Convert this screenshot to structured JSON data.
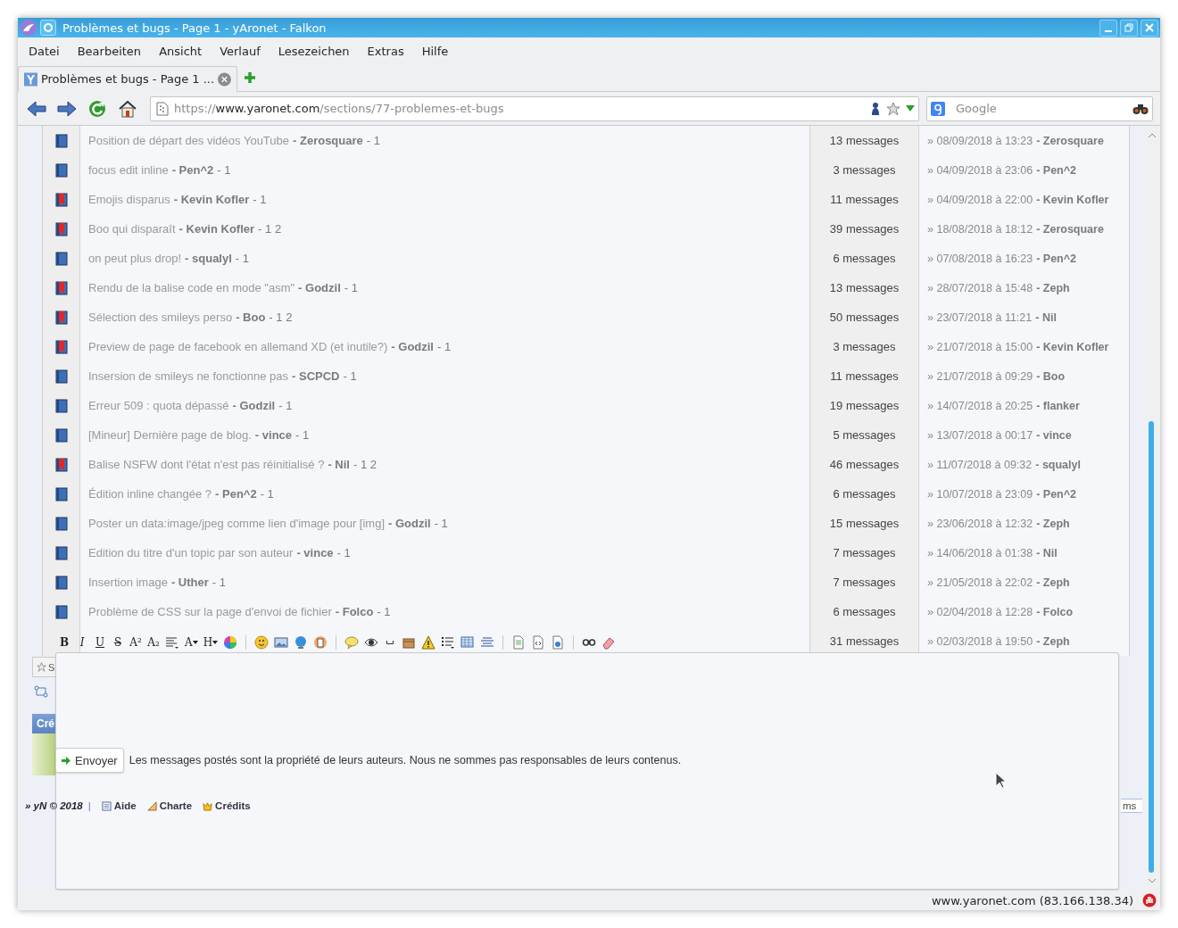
{
  "window": {
    "title": "Problèmes et bugs - Page 1 - yAronet - Falkon"
  },
  "menu": [
    "Datei",
    "Bearbeiten",
    "Ansicht",
    "Verlauf",
    "Lesezeichen",
    "Extras",
    "Hilfe"
  ],
  "tabs": [
    {
      "label": "Problèmes et bugs - Page 1 ...",
      "selected": true
    }
  ],
  "address": {
    "scheme": "https://",
    "host": "www.yaronet.com",
    "path": "/sections/77-problemes-et-bugs"
  },
  "search": {
    "placeholder": "Google"
  },
  "topics": [
    {
      "flagged": false,
      "title": "Position de départ des vidéos YouTube",
      "author": "- Zerosquare",
      "pages": "- 1",
      "messages": "13 messages",
      "date": "» 08/09/2018 à 13:23",
      "last_author": "- Zerosquare"
    },
    {
      "flagged": false,
      "title": "focus edit inline",
      "author": "- Pen^2",
      "pages": "- 1",
      "messages": "3 messages",
      "date": "» 04/09/2018 à 23:06",
      "last_author": "- Pen^2"
    },
    {
      "flagged": true,
      "title": "Emojis disparus",
      "author": "- Kevin Kofler",
      "pages": "- 1",
      "messages": "11 messages",
      "date": "» 04/09/2018 à 22:00",
      "last_author": "- Kevin Kofler"
    },
    {
      "flagged": true,
      "title": "Boo qui disparaît",
      "author": "- Kevin Kofler",
      "pages": "- 1 2",
      "messages": "39 messages",
      "date": "» 18/08/2018 à 18:12",
      "last_author": "- Zerosquare"
    },
    {
      "flagged": false,
      "title": "on peut plus drop!",
      "author": "- squalyl",
      "pages": "- 1",
      "messages": "6 messages",
      "date": "» 07/08/2018 à 16:23",
      "last_author": "- Pen^2"
    },
    {
      "flagged": true,
      "title": "Rendu de la balise code en mode \"asm\"",
      "author": "- Godzil",
      "pages": "- 1",
      "messages": "13 messages",
      "date": "» 28/07/2018 à 15:48",
      "last_author": "- Zeph"
    },
    {
      "flagged": true,
      "title": "Sélection des smileys perso",
      "author": "- Boo",
      "pages": "- 1 2",
      "messages": "50 messages",
      "date": "» 23/07/2018 à 11:21",
      "last_author": "- Nil"
    },
    {
      "flagged": true,
      "title": "Preview de page de facebook en allemand XD (et inutile?)",
      "author": "- Godzil",
      "pages": "- 1",
      "messages": "3 messages",
      "date": "» 21/07/2018 à 15:00",
      "last_author": "- Kevin Kofler"
    },
    {
      "flagged": false,
      "title": "Insersion de smileys ne fonctionne pas",
      "author": "- SCPCD",
      "pages": "- 1",
      "messages": "11 messages",
      "date": "» 21/07/2018 à 09:29",
      "last_author": "- Boo"
    },
    {
      "flagged": false,
      "title": "Erreur 509 : quota dépassé",
      "author": "- Godzil",
      "pages": "- 1",
      "messages": "19 messages",
      "date": "» 14/07/2018 à 20:25",
      "last_author": "- flanker"
    },
    {
      "flagged": false,
      "title": "[Mineur] Dernière page de blog.",
      "author": "- vince",
      "pages": "- 1",
      "messages": "5 messages",
      "date": "» 13/07/2018 à 00:17",
      "last_author": "- vince"
    },
    {
      "flagged": true,
      "title": "Balise NSFW dont l'état n'est pas réinitialisé ?",
      "author": "- Nil",
      "pages": "- 1 2",
      "messages": "46 messages",
      "date": "» 11/07/2018 à 09:32",
      "last_author": "- squalyl"
    },
    {
      "flagged": false,
      "title": "Édition inline changée ?",
      "author": "- Pen^2",
      "pages": "- 1",
      "messages": "6 messages",
      "date": "» 10/07/2018 à 23:09",
      "last_author": "- Pen^2"
    },
    {
      "flagged": false,
      "title": "Poster un data:image/jpeg comme lien d'image pour [img]",
      "author": "- Godzil",
      "pages": "- 1",
      "messages": "15 messages",
      "date": "» 23/06/2018 à 12:32",
      "last_author": "- Zeph"
    },
    {
      "flagged": false,
      "title": "Edition du titre d'un topic par son auteur",
      "author": "- vince",
      "pages": "- 1",
      "messages": "7 messages",
      "date": "» 14/06/2018 à 01:38",
      "last_author": "- Nil"
    },
    {
      "flagged": false,
      "title": "Insertion image",
      "author": "- Uther",
      "pages": "- 1",
      "messages": "7 messages",
      "date": "» 21/05/2018 à 22:02",
      "last_author": "- Zeph"
    },
    {
      "flagged": false,
      "title": "Problème de CSS sur la page d'envoi de fichier",
      "author": "- Folco",
      "pages": "- 1",
      "messages": "6 messages",
      "date": "» 02/04/2018 à 12:28",
      "last_author": "- Folco"
    },
    {
      "messages": "31 messages",
      "date": "» 02/03/2018 à 19:50",
      "last_author": "- Zeph"
    }
  ],
  "toolbar": [
    {
      "kind": "bold",
      "label": "B"
    },
    {
      "kind": "italic",
      "label": "I"
    },
    {
      "kind": "underline",
      "label": "U"
    },
    {
      "kind": "strike",
      "label": "S"
    },
    {
      "kind": "letter",
      "label": "A²"
    },
    {
      "kind": "letter",
      "label": "A₂"
    },
    {
      "kind": "align"
    },
    {
      "kind": "dropdown",
      "label": "A"
    },
    {
      "kind": "dropdown",
      "label": "H"
    },
    {
      "kind": "palette"
    },
    {
      "kind": "separator"
    },
    {
      "kind": "smiley"
    },
    {
      "kind": "image"
    },
    {
      "kind": "globe"
    },
    {
      "kind": "media"
    },
    {
      "kind": "separator"
    },
    {
      "kind": "speech"
    },
    {
      "kind": "eye"
    },
    {
      "kind": "space"
    },
    {
      "kind": "box"
    },
    {
      "kind": "warning"
    },
    {
      "kind": "list"
    },
    {
      "kind": "table"
    },
    {
      "kind": "center"
    },
    {
      "kind": "separator"
    },
    {
      "kind": "page"
    },
    {
      "kind": "code"
    },
    {
      "kind": "web"
    },
    {
      "kind": "separator"
    },
    {
      "kind": "link"
    },
    {
      "kind": "eraser"
    }
  ],
  "editor": {
    "send_button": "Envoyer",
    "notice": "Les messages postés sont la propriété de leurs auteurs. Nous ne sommes pas responsables de leurs contenus."
  },
  "behind": {
    "bar_text": "S",
    "header_text": "Cré"
  },
  "footer": {
    "copyright": "» yN © 2018",
    "separator": "|",
    "links": [
      {
        "kind": "help",
        "label": "Aide"
      },
      {
        "kind": "rules",
        "label": "Charte"
      },
      {
        "kind": "credits",
        "label": "Crédits"
      }
    ],
    "right_text": "ms"
  },
  "status_bar": {
    "text": "www.yaronet.com (83.166.138.34)"
  }
}
